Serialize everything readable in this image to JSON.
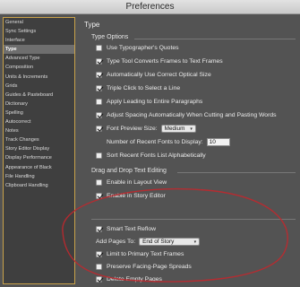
{
  "window": {
    "title": "Preferences"
  },
  "sidebar": {
    "items": [
      {
        "label": "General"
      },
      {
        "label": "Sync Settings"
      },
      {
        "label": "Interface"
      },
      {
        "label": "Type",
        "selected": true
      },
      {
        "label": "Advanced Type"
      },
      {
        "label": "Composition"
      },
      {
        "label": "Units & Increments"
      },
      {
        "label": "Grids"
      },
      {
        "label": "Guides & Pasteboard"
      },
      {
        "label": "Dictionary"
      },
      {
        "label": "Spelling"
      },
      {
        "label": "Autocorrect"
      },
      {
        "label": "Notes"
      },
      {
        "label": "Track Changes"
      },
      {
        "label": "Story Editor Display"
      },
      {
        "label": "Display Performance"
      },
      {
        "label": "Appearance of Black"
      },
      {
        "label": "File Handling"
      },
      {
        "label": "Clipboard Handling"
      }
    ]
  },
  "page": {
    "heading": "Type"
  },
  "type_options": {
    "title": "Type Options",
    "typographers_quotes": {
      "label": "Use Typographer's Quotes",
      "checked": false
    },
    "type_tool_converts": {
      "label": "Type Tool Converts Frames to Text Frames",
      "checked": true
    },
    "optical_size": {
      "label": "Automatically Use Correct Optical Size",
      "checked": true
    },
    "triple_click": {
      "label": "Triple Click to Select a Line",
      "checked": true
    },
    "apply_leading": {
      "label": "Apply Leading to Entire Paragraphs",
      "checked": false
    },
    "adjust_spacing": {
      "label": "Adjust Spacing Automatically When Cutting and Pasting Words",
      "checked": true
    },
    "font_preview": {
      "label": "Font Preview Size:",
      "value": "Medium",
      "checked": true
    },
    "recent_fonts": {
      "label": "Number of Recent Fonts to Display:",
      "value": "10"
    },
    "sort_recent": {
      "label": "Sort Recent Fonts List Alphabetically",
      "checked": false
    }
  },
  "drag_drop": {
    "title": "Drag and Drop Text Editing",
    "layout_view": {
      "label": "Enable in Layout View",
      "checked": false
    },
    "story_editor": {
      "label": "Enable in Story Editor",
      "checked": true
    }
  },
  "smart_reflow": {
    "smart_text_reflow": {
      "label": "Smart Text Reflow",
      "checked": true
    },
    "add_pages_to": {
      "label": "Add Pages To:",
      "value": "End of Story"
    },
    "limit_primary": {
      "label": "Limit to Primary Text Frames",
      "checked": true
    },
    "preserve_facing": {
      "label": "Preserve Facing-Page Spreads",
      "checked": false
    },
    "delete_empty": {
      "label": "Delete Empty Pages",
      "checked": true
    }
  },
  "colors": {
    "background": "#535353",
    "sidebar_border": "#c9a24a",
    "annotation_circle": "#c0282d"
  }
}
